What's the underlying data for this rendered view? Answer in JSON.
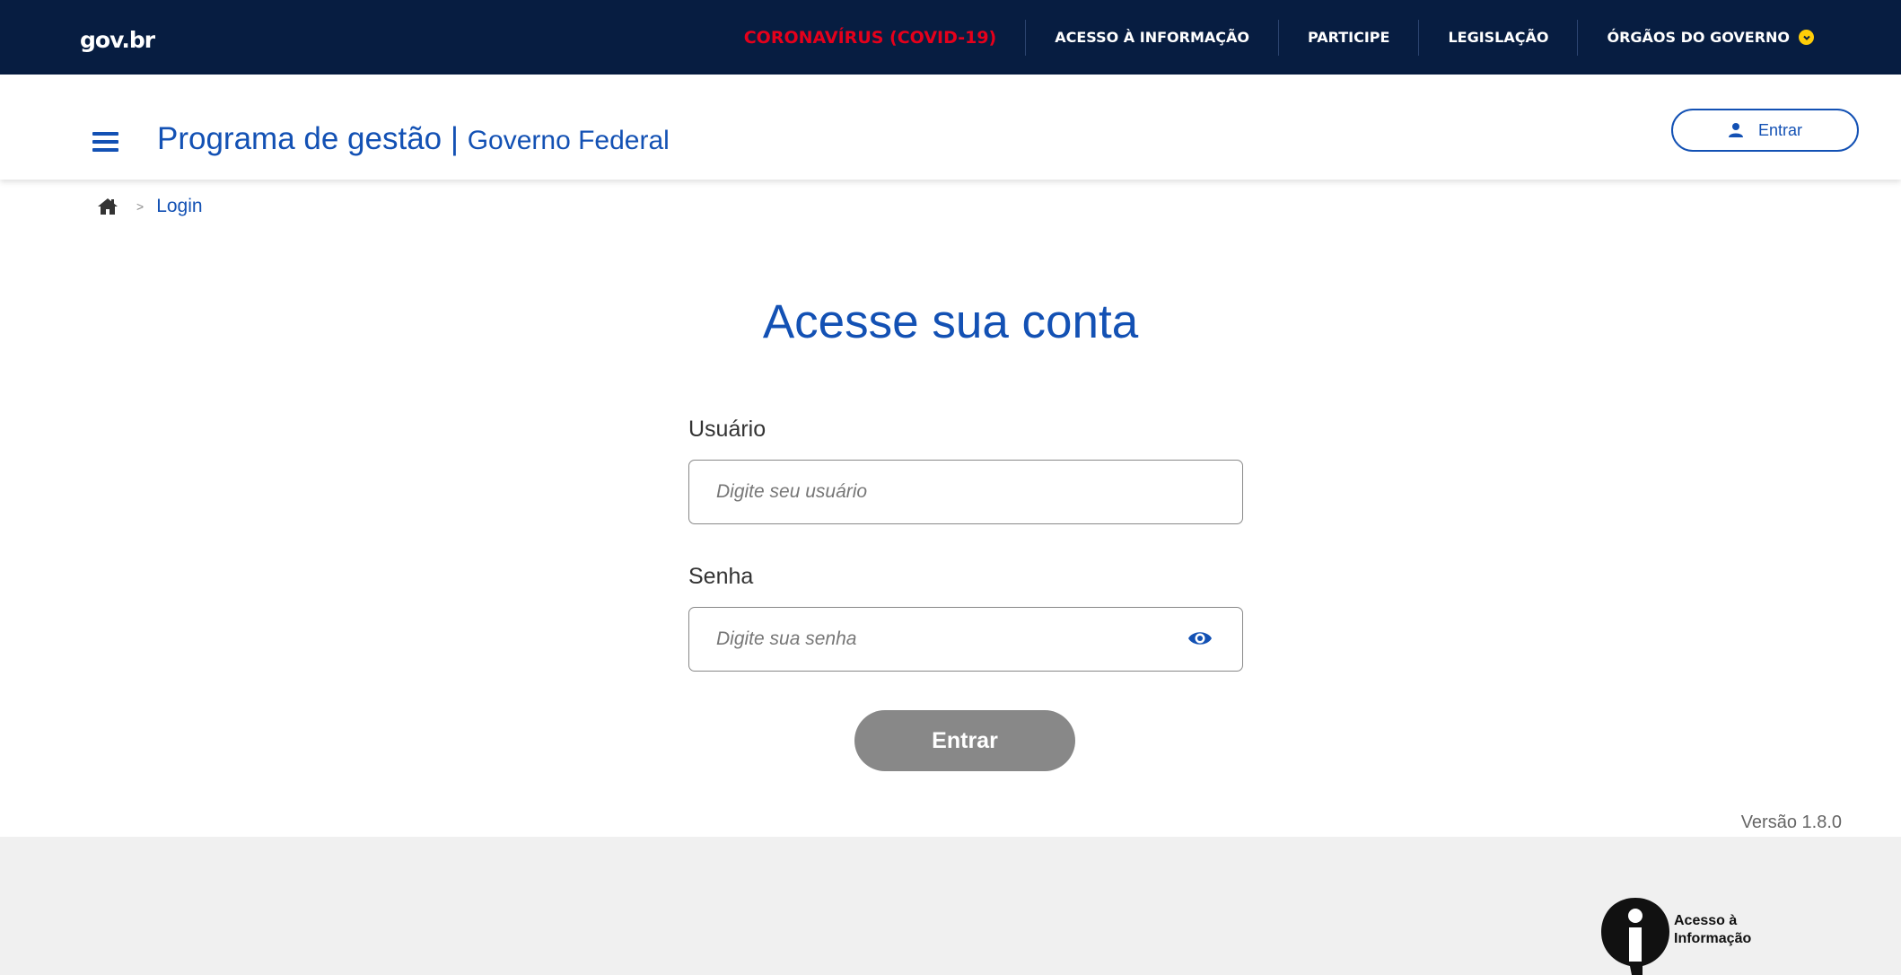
{
  "govbar": {
    "logo": "gov.br",
    "links": [
      {
        "label": "CORONAVÍRUS (COVID-19)"
      },
      {
        "label": "ACESSO À INFORMAÇÃO"
      },
      {
        "label": "PARTICIPE"
      },
      {
        "label": "LEGISLAÇÃO"
      },
      {
        "label": "ÓRGÃOS DO GOVERNO"
      }
    ],
    "covid_color": "#e5001b",
    "background": "#071d41"
  },
  "header": {
    "title": "Programa de gestão",
    "separator": " | ",
    "subtitle": "Governo Federal",
    "login_label": "Entrar",
    "menu_icon": "hamburger-menu-icon",
    "user_icon": "user-icon"
  },
  "breadcrumb": {
    "separator": ">",
    "current": "Login",
    "home_icon": "home-icon"
  },
  "form": {
    "title": "Acesse sua conta",
    "user_label": "Usuário",
    "user_placeholder": "Digite seu usuário",
    "password_label": "Senha",
    "password_placeholder": "Digite sua senha",
    "eye_icon": "eye-icon",
    "submit_label": "Entrar"
  },
  "version": "Versão 1.8.0",
  "footer": {
    "info_line1": "Acesso à",
    "info_line2": "Informação",
    "info_icon": "info-icon"
  },
  "colors": {
    "primary": "#1351b4",
    "button_disabled": "#888888",
    "footer_bg": "#f0f0f0"
  }
}
